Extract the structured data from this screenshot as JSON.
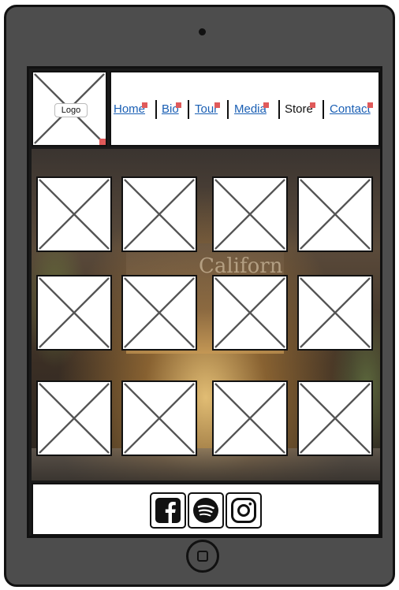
{
  "logo": {
    "label": "Logo"
  },
  "nav": {
    "items": [
      {
        "label": "Home",
        "current": false
      },
      {
        "label": "Bio",
        "current": false
      },
      {
        "label": "Tour",
        "current": false
      },
      {
        "label": "Media",
        "current": false
      },
      {
        "label": "Store",
        "current": true
      },
      {
        "label": "Contact",
        "current": false
      }
    ]
  },
  "hero": {
    "sign_text": "Californ"
  },
  "gallery": {
    "rows": 3,
    "columns": 4
  },
  "social": [
    {
      "name": "facebook",
      "icon": "facebook-icon"
    },
    {
      "name": "spotify",
      "icon": "spotify-icon"
    },
    {
      "name": "instagram",
      "icon": "instagram-icon"
    }
  ],
  "colors": {
    "link": "#1a5fb4",
    "device": "#4d4d4d",
    "annotation_marker": "#e05a5a"
  }
}
